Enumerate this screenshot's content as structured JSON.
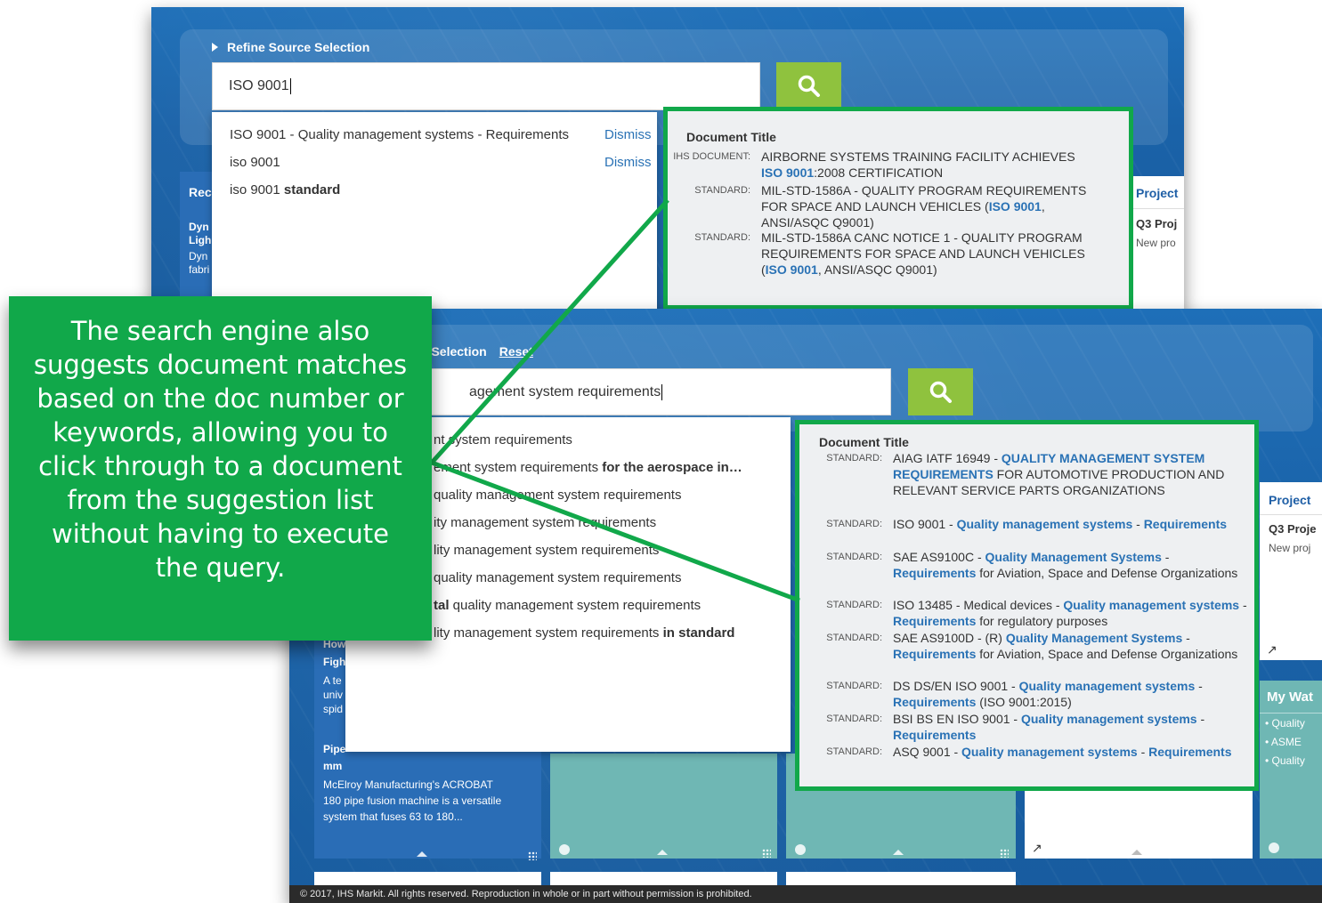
{
  "annotation": {
    "text": "The search engine also suggests document matches based on the doc number or keywords, allowing you to click through to a document from the suggestion list without having to execute the query.",
    "color": "#11a84a"
  },
  "screenshot_1": {
    "refine_label": "Refine Source Selection",
    "search_value": "ISO 9001",
    "search_icon": "magnifier-icon",
    "suggestions": [
      {
        "text": "ISO 9001 - Quality management systems - Requirements",
        "dismiss": "Dismiss"
      },
      {
        "text": "iso 9001",
        "dismiss": "Dismiss"
      },
      {
        "prefix": "iso 9001 ",
        "bold": "standard"
      }
    ],
    "behind_card": {
      "heading": "Rec",
      "lines": [
        "Dyn",
        "Ligh",
        "Dyn",
        "fabri"
      ]
    },
    "project_card": {
      "title": "Project",
      "item": "Q3 Proj",
      "sub": "New pro"
    },
    "doc_panel": {
      "heading": "Document Title",
      "rows": [
        {
          "type": "IHS DOCUMENT:",
          "parts": [
            {
              "t": "AIRBORNE SYSTEMS TRAINING FACILITY ACHIEVES "
            },
            {
              "t": "ISO 9001",
              "hl": true
            },
            {
              "t": ":2008 CERTIFICATION"
            }
          ]
        },
        {
          "type": "STANDARD:",
          "parts": [
            {
              "t": "MIL-STD-1586A - QUALITY PROGRAM REQUIREMENTS FOR SPACE AND LAUNCH VEHICLES ("
            },
            {
              "t": "ISO 9001",
              "hl": true
            },
            {
              "t": ", ANSI/ASQC Q9001)"
            }
          ]
        },
        {
          "type": "STANDARD:",
          "parts": [
            {
              "t": "MIL-STD-1586A CANC NOTICE 1 - QUALITY PROGRAM REQUIREMENTS FOR SPACE AND LAUNCH VEHICLES ("
            },
            {
              "t": "ISO 9001",
              "hl": true
            },
            {
              "t": ", ANSI/ASQC Q9001)"
            }
          ]
        }
      ]
    }
  },
  "screenshot_2": {
    "refine_label": "ce Selection",
    "reset_label": "Reset",
    "search_value": "agement system requirements",
    "search_icon": "magnifier-icon",
    "suggestions": [
      {
        "prefix": "nt system requirements",
        "bold": ""
      },
      {
        "prefix": "ement system requirements ",
        "bold": "for the aerospace in…"
      },
      {
        "prefix": "quality management system requirements",
        "bold": ""
      },
      {
        "prefix": "ity management system requirements",
        "bold": ""
      },
      {
        "prefix": "lity management system requirements",
        "bold": ""
      },
      {
        "prefix": "quality management system requirements",
        "bold": ""
      },
      {
        "prefix_bold": "tal",
        "prefix": " quality management system requirements",
        "bold": ""
      },
      {
        "prefix": "lity management system requirements ",
        "bold": "in standard"
      }
    ],
    "left_tile": {
      "lines": [
        "How",
        "Figh",
        "A te",
        "univ",
        "spid"
      ],
      "pipe_title": [
        "Pipe",
        "mm"
      ],
      "pipe_text": [
        "McElroy Manufacturing's ACROBAT",
        "180 pipe fusion machine is a versatile",
        "system that fuses 63 to 180..."
      ]
    },
    "project_card": {
      "title": "Project",
      "item": "Q3 Proje",
      "sub": "New proj"
    },
    "watch_card": {
      "title": "My Wat",
      "items": [
        "Quality",
        "ASME",
        "Quality"
      ]
    },
    "doc_panel": {
      "heading": "Document Title",
      "rows": [
        {
          "type": "STANDARD:",
          "parts": [
            {
              "t": "AIAG IATF 16949 - "
            },
            {
              "t": "QUALITY MANAGEMENT SYSTEM REQUIREMENTS",
              "hl": true
            },
            {
              "t": " FOR AUTOMOTIVE PRODUCTION AND RELEVANT SERVICE PARTS ORGANIZATIONS"
            }
          ]
        },
        {
          "type": "STANDARD:",
          "parts": [
            {
              "t": "ISO 9001 - "
            },
            {
              "t": "Quality management systems",
              "hl": true
            },
            {
              "t": " - "
            },
            {
              "t": "Requirements",
              "hl": true
            }
          ]
        },
        {
          "type": "STANDARD:",
          "parts": [
            {
              "t": "SAE AS9100C - "
            },
            {
              "t": "Quality Management Systems",
              "hl": true
            },
            {
              "t": " - "
            },
            {
              "t": "Requirements",
              "hl": true
            },
            {
              "t": " for Aviation, Space and Defense Organizations"
            }
          ]
        },
        {
          "type": "STANDARD:",
          "parts": [
            {
              "t": "ISO 13485 - Medical devices - "
            },
            {
              "t": "Quality management systems",
              "hl": true
            },
            {
              "t": " - "
            },
            {
              "t": "Requirements",
              "hl": true
            },
            {
              "t": " for regulatory purposes"
            }
          ]
        },
        {
          "type": "STANDARD:",
          "parts": [
            {
              "t": "SAE AS9100D - (R) "
            },
            {
              "t": "Quality Management Systems",
              "hl": true
            },
            {
              "t": " - "
            },
            {
              "t": "Requirements",
              "hl": true
            },
            {
              "t": " for Aviation, Space and Defense Organizations"
            }
          ]
        },
        {
          "type": "STANDARD:",
          "parts": [
            {
              "t": "DS DS/EN ISO 9001 - "
            },
            {
              "t": "Quality management systems",
              "hl": true
            },
            {
              "t": " - "
            },
            {
              "t": "Requirements",
              "hl": true
            },
            {
              "t": " (ISO 9001:2015)"
            }
          ]
        },
        {
          "type": "STANDARD:",
          "parts": [
            {
              "t": "BSI BS EN ISO 9001 - "
            },
            {
              "t": "Quality management systems",
              "hl": true
            },
            {
              "t": " - "
            },
            {
              "t": "Requirements",
              "hl": true
            }
          ]
        },
        {
          "type": "STANDARD:",
          "parts": [
            {
              "t": "ASQ 9001 - "
            },
            {
              "t": "Quality management systems",
              "hl": true
            },
            {
              "t": " - "
            },
            {
              "t": "Requirements",
              "hl": true
            }
          ]
        }
      ]
    },
    "copyright": "© 2017, IHS Markit. All rights reserved. Reproduction in whole or in part without permission is prohibited."
  },
  "colors": {
    "accent_green": "#11a84a",
    "search_button": "#8fc23e",
    "link_blue": "#2a72b5",
    "tile_teal": "#6fb7b4"
  }
}
